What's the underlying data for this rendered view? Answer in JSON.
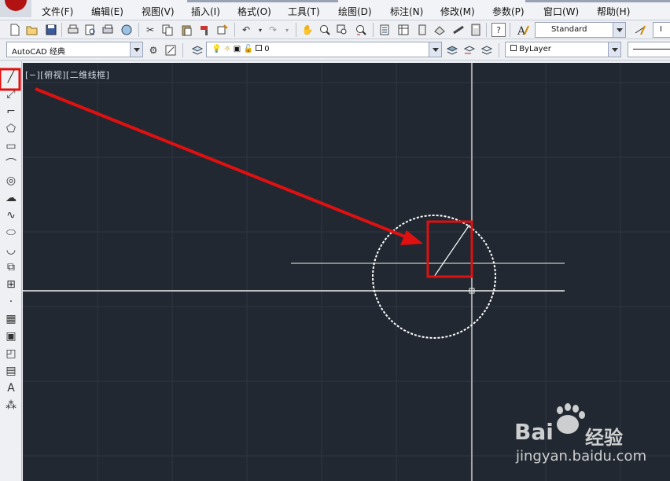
{
  "menus": [
    "文件(F)",
    "编辑(E)",
    "视图(V)",
    "插入(I)",
    "格式(O)",
    "工具(T)",
    "绘图(D)",
    "标注(N)",
    "修改(M)",
    "参数(P)",
    "窗口(W)",
    "帮助(H)"
  ],
  "toolbar": {
    "text_style": "Standard",
    "text_style_2": "I"
  },
  "workspace": {
    "name": "AutoCAD 经典"
  },
  "layer": {
    "current": "0",
    "color": "ByLayer"
  },
  "viewport": {
    "label": "[−][俯视][二维线框]"
  },
  "watermark": {
    "brand_prefix": "Bai",
    "brand_suffix": "经验",
    "url": "jingyan.baidu.com"
  },
  "colors": {
    "canvas_bg": "#212831",
    "annotation_red": "#e01010",
    "drawing_white": "#ffffff"
  },
  "left_tools": [
    "line-icon",
    "construction-line-icon",
    "polyline-icon",
    "polygon-icon",
    "rectangle-icon",
    "arc-icon",
    "circle-icon",
    "revision-cloud-icon",
    "spline-icon",
    "ellipse-icon",
    "ellipse-arc-icon",
    "insert-block-icon",
    "make-block-icon",
    "point-icon",
    "hatch-icon",
    "gradient-icon",
    "region-icon",
    "table-icon",
    "multiline-text-icon",
    "add-selected-icon"
  ]
}
